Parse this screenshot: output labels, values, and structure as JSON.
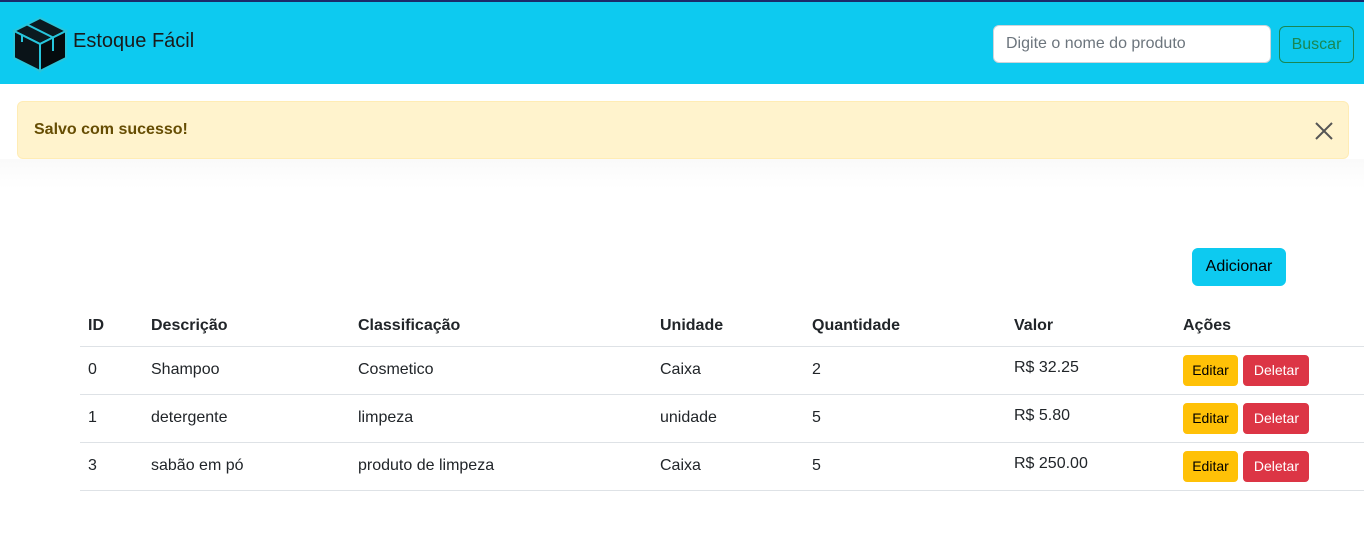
{
  "navbar": {
    "brand": "Estoque Fácil",
    "search": {
      "placeholder": "Digite o nome do produto",
      "value": ""
    },
    "search_button": "Buscar",
    "background": "#0dcaf0"
  },
  "alert": {
    "message": "Salvo com sucesso!",
    "close_icon": "close-icon"
  },
  "toolbar": {
    "add_button": "Adicionar"
  },
  "table": {
    "headers": [
      "ID",
      "Descrição",
      "Classificação",
      "Unidade",
      "Quantidade",
      "Valor",
      "Ações"
    ],
    "rows": [
      {
        "id": "0",
        "descricao": "Shampoo",
        "classificacao": "Cosmetico",
        "unidade": "Caixa",
        "quantidade": "2",
        "valor": "R$ 32.25"
      },
      {
        "id": "1",
        "descricao": "detergente",
        "classificacao": "limpeza",
        "unidade": "unidade",
        "quantidade": "5",
        "valor": "R$ 5.80"
      },
      {
        "id": "3",
        "descricao": "sabão em pó",
        "classificacao": "produto de limpeza",
        "unidade": "Caixa",
        "quantidade": "5",
        "valor": "R$ 250.00"
      }
    ],
    "edit_label": "Editar",
    "delete_label": "Deletar"
  }
}
